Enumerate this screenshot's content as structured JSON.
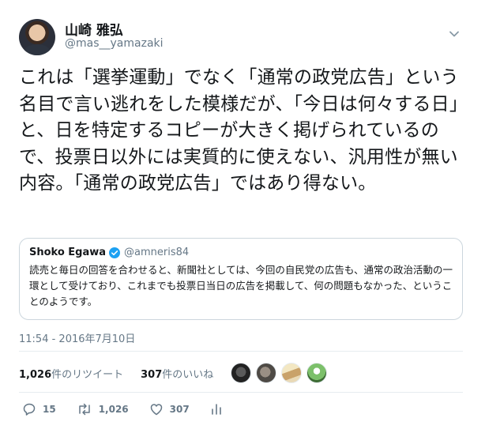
{
  "author": {
    "name": "山崎 雅弘",
    "handle": "@mas__yamazaki"
  },
  "tweet": {
    "text": "これは「選挙運動」でなく「通常の政党広告」という名目で言い逃れをした模様だが、「今日は何々する日」と、日を特定するコピーが大きく掲げられているので、投票日以外には実質的に使えない、汎用性が無い内容。「通常の政党広告」ではあり得ない。"
  },
  "quoted": {
    "name": "Shoko Egawa",
    "handle": "@amneris84",
    "text": "読売と毎日の回答を合わせると、新聞社としては、今回の自民党の広告も、通常の政治活動の一環として受けており、これまでも投票日当日の広告を掲載して、何の問題もなかった、ということのようです。"
  },
  "timestamp": "11:54 - 2016年7月10日",
  "stats": {
    "retweets_count": "1,026",
    "retweets_label": "件のリツイート",
    "likes_count": "307",
    "likes_label": "件のいいね"
  },
  "actions": {
    "reply_count": "15",
    "retweet_count": "1,026",
    "like_count": "307"
  },
  "colors": {
    "verified": "#1da1f2",
    "secondary_text": "#657786",
    "border": "#ccd6dd"
  },
  "icons": [
    "chevron-down-icon",
    "verified-badge-icon",
    "reply-icon",
    "retweet-icon",
    "like-icon",
    "analytics-icon"
  ]
}
